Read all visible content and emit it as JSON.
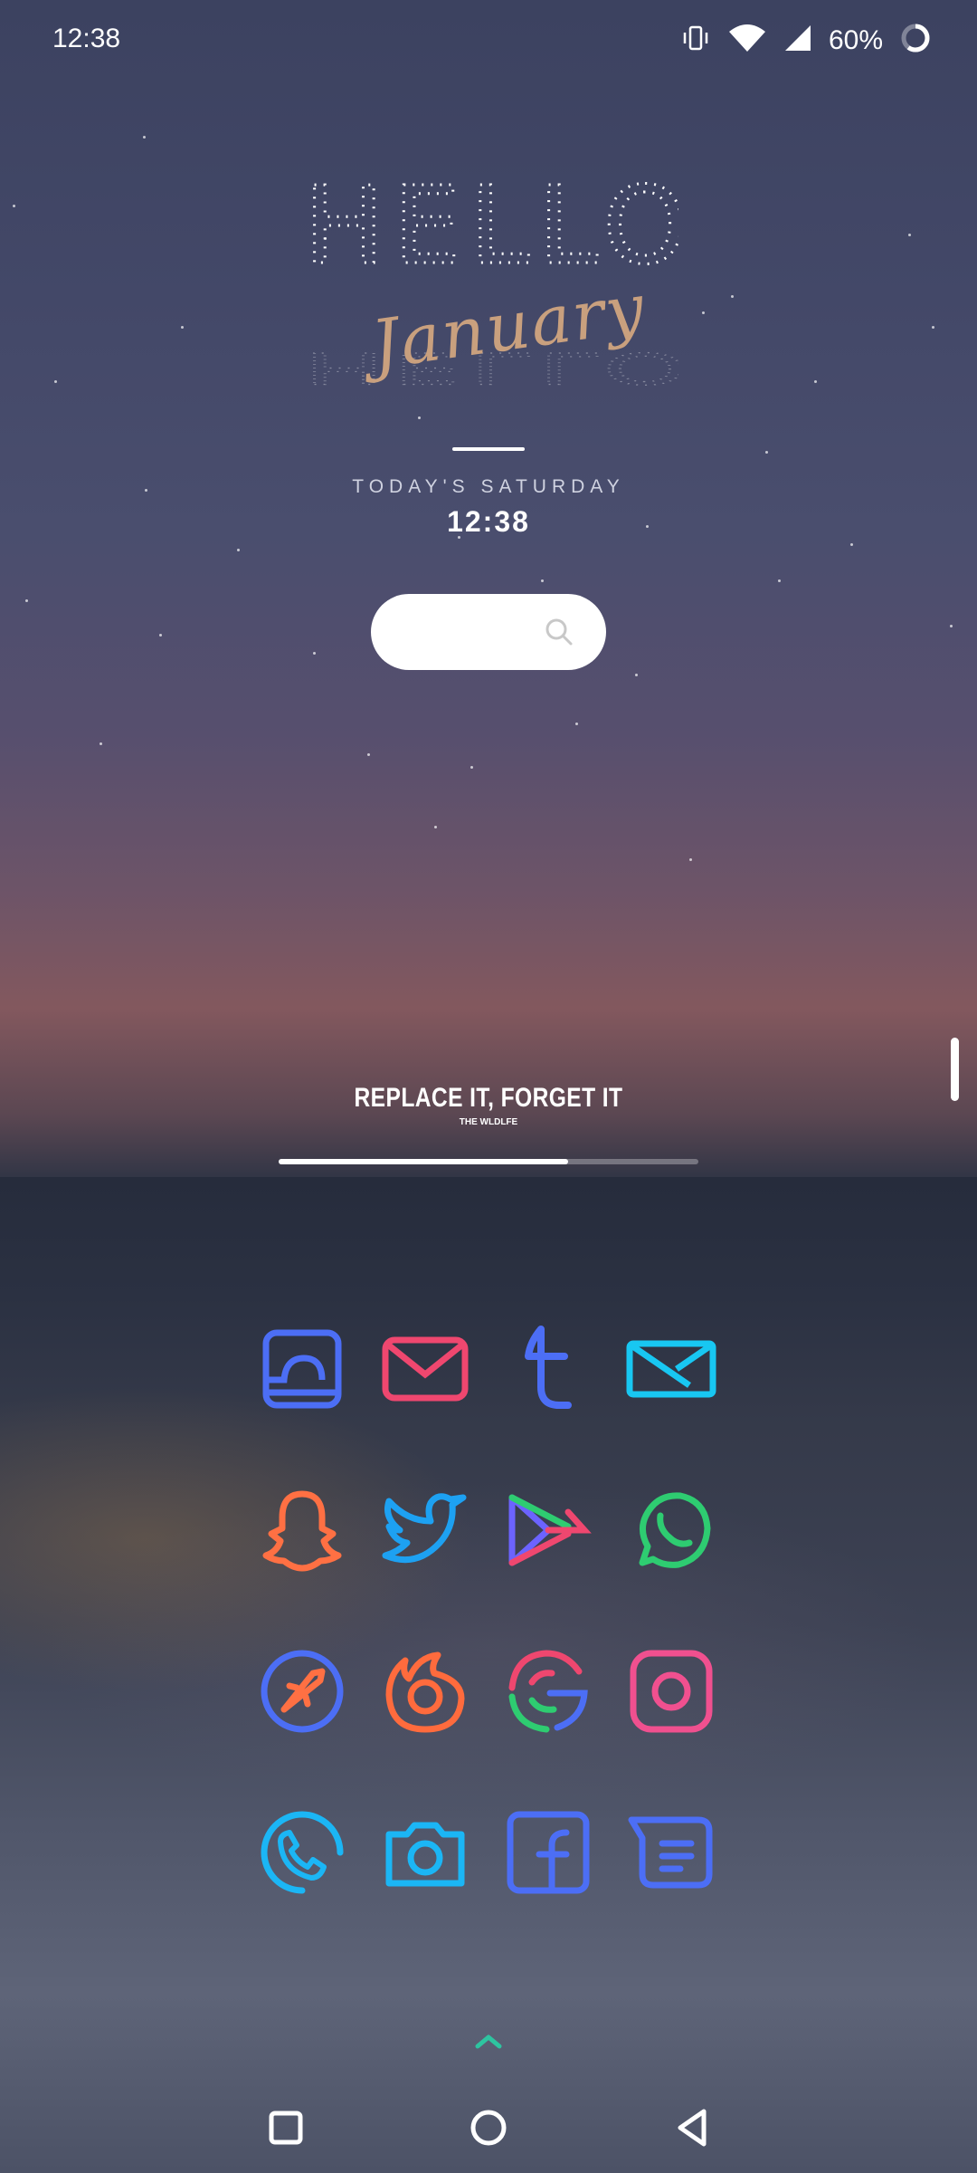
{
  "status_bar": {
    "time": "12:38",
    "battery_percent": "60%",
    "icons": [
      "vibrate-icon",
      "wifi-icon",
      "cell-signal-icon",
      "battery-ring-icon"
    ]
  },
  "widget": {
    "greeting": "HELLO",
    "month": "January",
    "day_line": "TODAY'S SATURDAY",
    "clock": "12:38"
  },
  "music": {
    "title": "REPLACE IT, FORGET IT",
    "artist": "THE WLDLFE",
    "progress": 0.69
  },
  "apps": [
    {
      "name": "drive-style-app-icon",
      "color": "#4c6ef5"
    },
    {
      "name": "mail-app-icon",
      "color": "#ef476f"
    },
    {
      "name": "tumblr-icon",
      "color": "#4c6ef5"
    },
    {
      "name": "envelope-icon",
      "color": "#18c7f2"
    },
    {
      "name": "snapchat-icon",
      "color": "#ff7043"
    },
    {
      "name": "twitter-icon",
      "color": "#1da1f2"
    },
    {
      "name": "play-store-icon",
      "color": "#6c63ff"
    },
    {
      "name": "whatsapp-icon",
      "color": "#2ecc71"
    },
    {
      "name": "rocket-browser-icon",
      "color": "#4c6ef5"
    },
    {
      "name": "firefox-icon",
      "color": "#ff6b3d"
    },
    {
      "name": "google-icon",
      "color": "#e94b5b"
    },
    {
      "name": "instagram-icon",
      "color": "#f0508f"
    },
    {
      "name": "phone-icon",
      "color": "#1bb6f5"
    },
    {
      "name": "camera-icon",
      "color": "#1bb6f5"
    },
    {
      "name": "facebook-icon",
      "color": "#4c6ef5"
    },
    {
      "name": "messages-icon",
      "color": "#4c6ef5"
    }
  ],
  "nav": {
    "items": [
      "recents-button",
      "home-button",
      "back-button"
    ]
  }
}
